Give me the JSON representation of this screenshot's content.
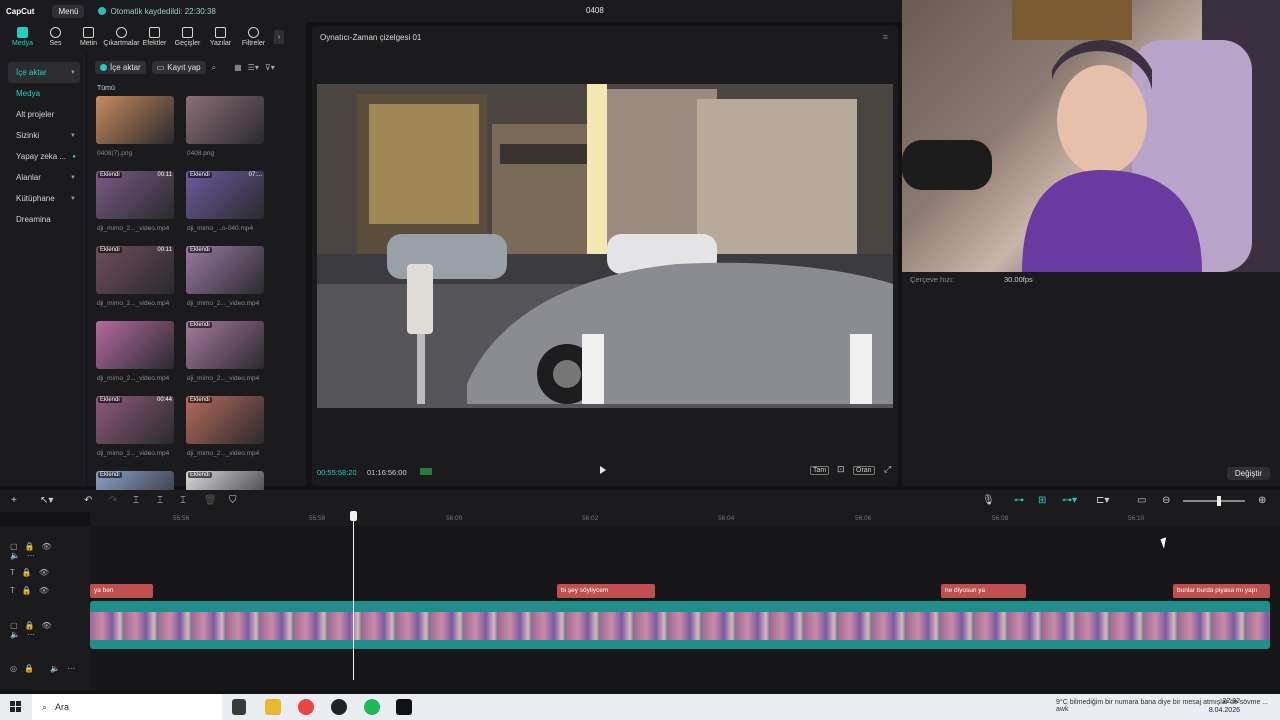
{
  "topbar": {
    "logo": "CapCut",
    "menu_label": "Menü",
    "autosave": "Otomatik kaydedildi: 22:30:38",
    "project_title": "0408"
  },
  "toolbar": {
    "tools": [
      "Medya",
      "Ses",
      "Metin",
      "Çıkartmalar",
      "Efektler",
      "Geçişler",
      "Yazılar",
      "Filtreler"
    ],
    "active": "Medya"
  },
  "sidebar": {
    "items": [
      {
        "label": "İçe aktar",
        "chevron": true
      },
      {
        "label": "Medya"
      },
      {
        "label": "Alt projeler"
      },
      {
        "label": "Sizinki",
        "chevron": true
      },
      {
        "label": "Yapay zeka ..."
      },
      {
        "label": "Alanlar",
        "chevron": true
      },
      {
        "label": "Kütüphane",
        "chevron": true
      },
      {
        "label": "Dreamina"
      }
    ]
  },
  "media": {
    "import_label": "İçe aktar",
    "record_label": "Kayıt yap",
    "all_label": "Tümü",
    "items": [
      {
        "name": "0408(7).png",
        "tag": "",
        "dur": "",
        "color": "#c78a5e"
      },
      {
        "name": "0408.png",
        "tag": "",
        "dur": "",
        "color": "#8c6f78"
      },
      {
        "name": "dji_mimo_2..._video.mp4",
        "tag": "Eklendi",
        "dur": "00:11",
        "color": "#7a5a86"
      },
      {
        "name": "dji_mimo_...o-040.mp4",
        "tag": "Eklendi",
        "dur": "07:...",
        "color": "#6d5a9e"
      },
      {
        "name": "dji_mimo_2..._video.mp4",
        "tag": "Eklendi",
        "dur": "00:11",
        "color": "#6e4e5a"
      },
      {
        "name": "dji_mimo_2..._video.mp4",
        "tag": "Eklendi",
        "dur": "",
        "color": "#9a7aa2"
      },
      {
        "name": "dji_mimo_2..._video.mp4",
        "tag": "",
        "dur": "",
        "color": "#b56aa0"
      },
      {
        "name": "dji_mimo_2..._video.mp4",
        "tag": "Eklendi",
        "dur": "",
        "color": "#a77a9e"
      },
      {
        "name": "dji_mimo_2..._video.mp4",
        "tag": "Eklendi",
        "dur": "00:44",
        "color": "#8e5a7a"
      },
      {
        "name": "dji_mimo_2..._video.mp4",
        "tag": "Eklendi",
        "dur": "",
        "color": "#b86a5a"
      },
      {
        "name": "",
        "tag": "Eklendi",
        "dur": "",
        "color": "#8aa0c8"
      },
      {
        "name": "",
        "tag": "Eklendi",
        "dur": "",
        "color": "#d8d8e0"
      }
    ]
  },
  "player": {
    "title": "Oynatıcı-Zaman çizelgesi 01",
    "current_time": "00:55:58:20",
    "total_time": "01:16:56:00",
    "full_label": "Tam",
    "ratio_label": "Oran"
  },
  "props": {
    "fps_label": "Çerçeve hızı:",
    "fps_value": "30.00fps",
    "change_label": "Değiştir"
  },
  "timeline": {
    "ruler": [
      "55:56",
      "55:58",
      "56:00",
      "56:02",
      "56:04",
      "56:06",
      "56:08",
      "56:10"
    ],
    "text_clips": [
      {
        "label": "ya ben"
      },
      {
        "label": "bi şey söyliycem"
      },
      {
        "label": "ne diyosun ya"
      },
      {
        "label": "bunlar burda piyasa mı yapı"
      }
    ]
  },
  "taskbar": {
    "search_placeholder": "Ara",
    "weather": "9°C",
    "notification": "bilmediğim bir numara bana diye bir mesaj atmışlar de sövme ... awk",
    "time": "22:32",
    "date": "8.04.2026"
  },
  "colors": {
    "accent": "#1fd0c0",
    "text_clip": "#c0504f",
    "video_track": "#1e8f8a"
  }
}
